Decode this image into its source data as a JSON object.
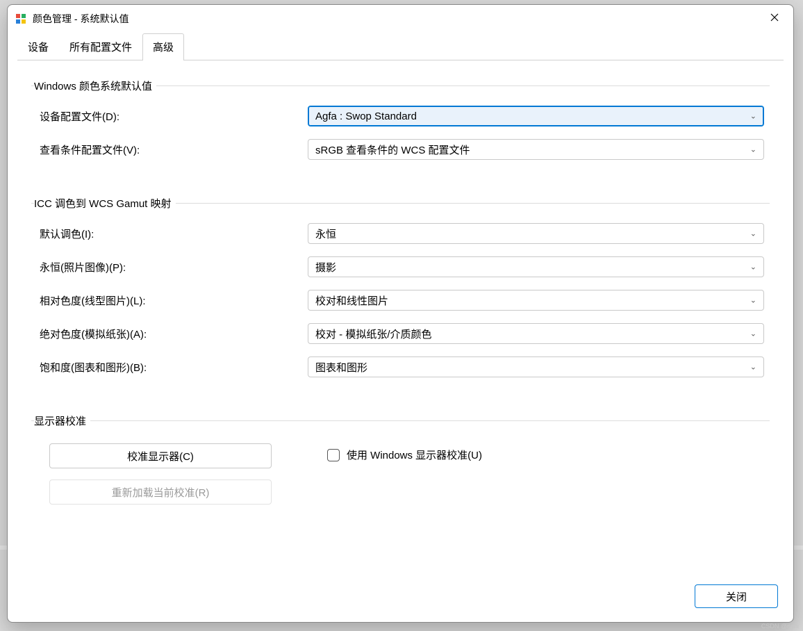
{
  "window": {
    "title": "颜色管理 - 系统默认值"
  },
  "tabs": {
    "devices": "设备",
    "all_profiles": "所有配置文件",
    "advanced": "高级"
  },
  "group_defaults": {
    "legend": "Windows 颜色系统默认值",
    "device_profile_label": "设备配置文件(D):",
    "device_profile_value": "Agfa : Swop Standard",
    "view_cond_label": "查看条件配置文件(V):",
    "view_cond_value": "sRGB 查看条件的 WCS 配置文件"
  },
  "group_gamut": {
    "legend": "ICC 调色到 WCS Gamut 映射",
    "default_intent_label": "默认调色(I):",
    "default_intent_value": "永恒",
    "perceptual_label": "永恒(照片图像)(P):",
    "perceptual_value": "摄影",
    "relative_label": "相对色度(线型图片)(L):",
    "relative_value": "校对和线性图片",
    "absolute_label": "绝对色度(模拟纸张)(A):",
    "absolute_value": "校对 - 模拟纸张/介质颜色",
    "saturation_label": "饱和度(图表和图形)(B):",
    "saturation_value": "图表和图形"
  },
  "group_calibration": {
    "legend": "显示器校准",
    "calibrate_button": "校准显示器(C)",
    "reload_button": "重新加载当前校准(R)",
    "use_windows_calib": "使用 Windows 显示器校准(U)"
  },
  "footer": {
    "close": "关闭"
  },
  "watermark": "CSDN @nani"
}
